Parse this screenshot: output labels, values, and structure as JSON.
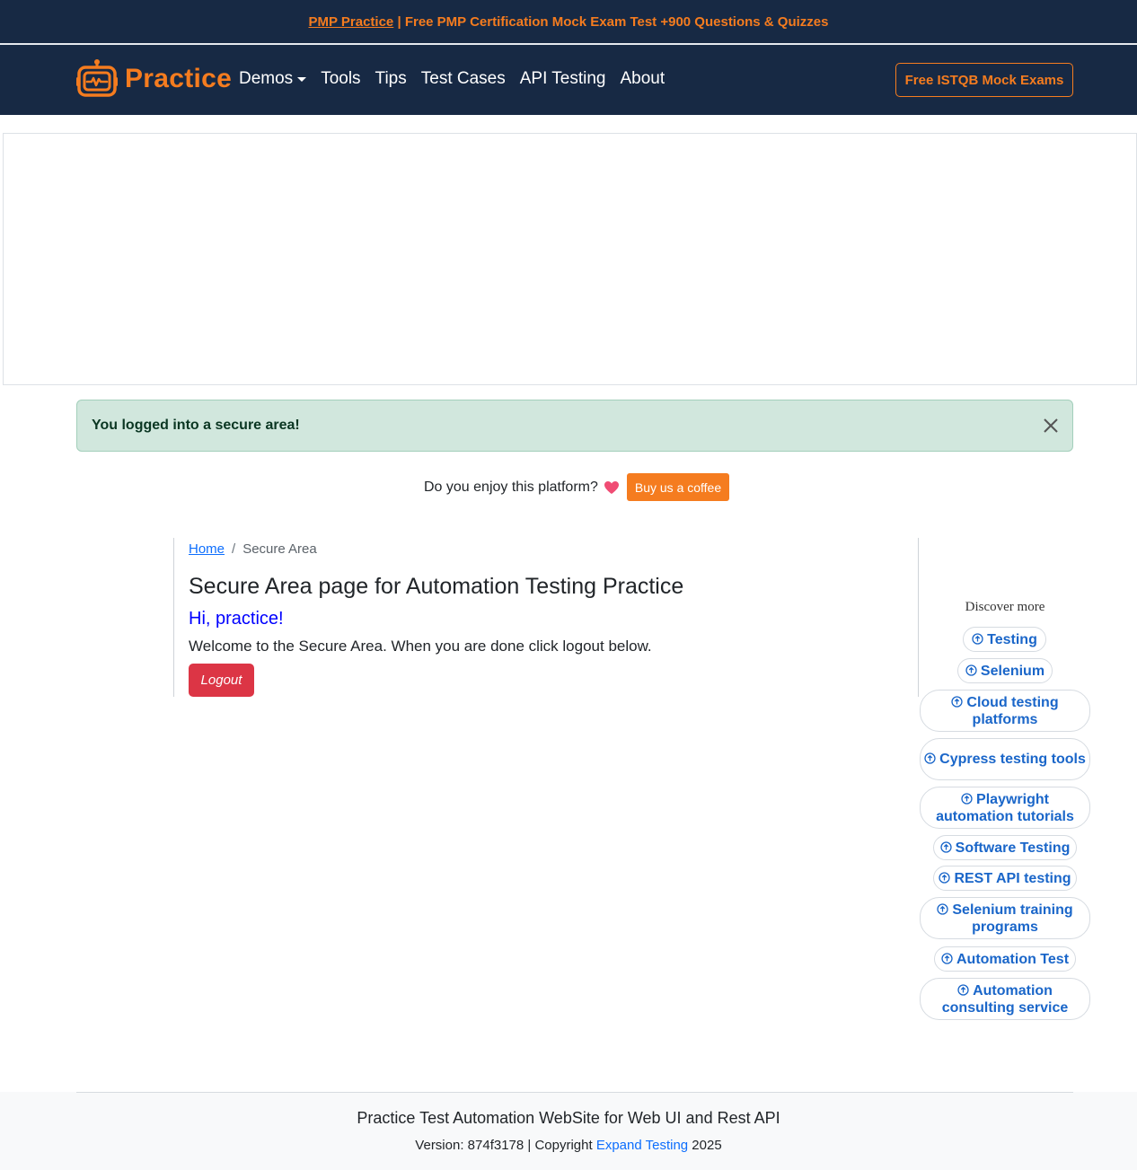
{
  "promo": {
    "link_text": "PMP Practice",
    "text": " | Free PMP Certification Mock Exam Test +900 Questions & Quizzes"
  },
  "nav": {
    "brand": "Practice",
    "items": [
      {
        "label": "Demos",
        "dropdown": true
      },
      {
        "label": "Tools"
      },
      {
        "label": "Tips"
      },
      {
        "label": "Test Cases"
      },
      {
        "label": "API Testing"
      },
      {
        "label": "About"
      }
    ],
    "cta": "Free ISTQB Mock Exams"
  },
  "alert": {
    "message": "You logged into a secure area!"
  },
  "coffee": {
    "prompt": "Do you enjoy this platform?",
    "button": "Buy us a coffee"
  },
  "breadcrumb": {
    "home": "Home",
    "separator": "/",
    "current": "Secure Area"
  },
  "main": {
    "title": "Secure Area page for Automation Testing Practice",
    "greeting": "Hi, practice!",
    "welcome": "Welcome to the Secure Area. When you are done click logout below.",
    "logout": "Logout"
  },
  "discover": {
    "title": "Discover more",
    "items": [
      "Testing",
      "Selenium",
      "Cloud testing platforms",
      "Cypress testing tools",
      "Playwright automation tutorials",
      "Software Testing",
      "REST API testing",
      "Selenium training programs",
      "Automation Test",
      "Automation consulting service"
    ]
  },
  "footer": {
    "title": "Practice Test Automation WebSite for Web UI and Rest API",
    "version_prefix": "Version: 874f3178 | Copyright ",
    "company": "Expand Testing",
    "year": " 2025"
  },
  "colors": {
    "navy": "#172944",
    "orange": "#f57c1f",
    "success_bg": "#d1e7dd",
    "danger": "#dc3545",
    "link_blue": "#1a66c9"
  }
}
